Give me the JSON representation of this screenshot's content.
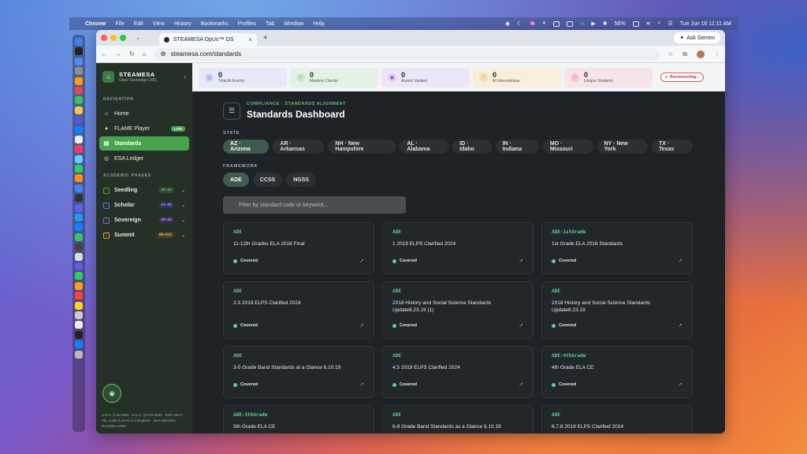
{
  "menubar": {
    "app": "Chrome",
    "items": [
      "File",
      "Edit",
      "View",
      "History",
      "Bookmarks",
      "Profiles",
      "Tab",
      "Window",
      "Help"
    ],
    "battery": "56%",
    "datetime": "Tue Jun 16  11:11 AM"
  },
  "browser": {
    "tab_title": "STEAMESA OpUs™ OS",
    "url": "steamesa.com/standards",
    "ask_gemini": "Ask Gemini"
  },
  "sidebar": {
    "brand": "STEAMESA",
    "subtitle": "Opus Sovereign LMS",
    "nav_heading": "NAVIGATION",
    "nav": [
      {
        "label": "Home",
        "icon": "home-icon"
      },
      {
        "label": "FLAME Player",
        "icon": "flame-icon",
        "badge": "LIVE"
      },
      {
        "label": "Standards",
        "icon": "standards-icon"
      },
      {
        "label": "ESA Ledger",
        "icon": "ledger-icon"
      }
    ],
    "phases_heading": "ACADEMIC PHASES",
    "phases": [
      {
        "label": "Seedling",
        "tag": "G1–G2",
        "color": "#4aa34f"
      },
      {
        "label": "Scholar",
        "tag": "G3–G5",
        "color": "#5b7be0"
      },
      {
        "label": "Sovereign",
        "tag": "G6–G8",
        "color": "#8a62d6"
      },
      {
        "label": "Summit",
        "tag": "G9–G12",
        "color": "#e0a23a"
      }
    ],
    "legal": "A.R.S. § 15-2401 · A.C.A. § 6-18-2501 · RSA 194-F · Ala. Code § 16-6J-1 Compliant · SHA-256 ESA Receipts Active"
  },
  "stats": [
    {
      "value": "0",
      "label": "Total AI Events",
      "bg": "#e6e9f8",
      "icon": "target-icon",
      "icolor": "#5b6fd6"
    },
    {
      "value": "0",
      "label": "Mastery Checks",
      "bg": "#e3f1e6",
      "icon": "check-icon",
      "icolor": "#4aa34f"
    },
    {
      "value": "0",
      "label": "Assets Vaulted",
      "bg": "#ece7f7",
      "icon": "vault-icon",
      "icolor": "#8a62d6"
    },
    {
      "value": "0",
      "label": "AI Interventions",
      "bg": "#f7efdc",
      "icon": "alert-icon",
      "icolor": "#d99a1c"
    },
    {
      "value": "0",
      "label": "Unique Students",
      "bg": "#f7e4ea",
      "icon": "students-icon",
      "icolor": "#d6557a"
    }
  ],
  "reconnecting": "Reconnecting...",
  "page": {
    "breadcrumb": "COMPLIANCE · STANDARDS ALIGNMENT",
    "title": "Standards Dashboard",
    "state_label": "STATE",
    "states": [
      "AZ · Arizona",
      "AR · Arkansas",
      "NH · New Hampshire",
      "AL · Alabama",
      "ID · Idaho",
      "IN · Indiana",
      "MO · Missouri",
      "NY · New York",
      "TX · Texas"
    ],
    "framework_label": "FRAMEWORK",
    "frameworks": [
      "ADE",
      "CCSS",
      "NGSS"
    ],
    "filter_placeholder": "Filter by standard code or keyword..."
  },
  "cards": [
    {
      "code": "ADE",
      "name": "11-12th Grades ELA 2016 Final",
      "status": "Covered"
    },
    {
      "code": "ADE",
      "name": "1 2019 ELPS Clarified 2024",
      "status": "Covered"
    },
    {
      "code": "ADE-1stGrade",
      "name": "1st Grade ELA 2016 Standards",
      "status": "Covered"
    },
    {
      "code": "ADE",
      "name": "2.3 2019 ELPS Clarified 2024",
      "status": "Covered"
    },
    {
      "code": "ADE",
      "name": "2018 History and Social Science Standards Update8.23.19 (1)",
      "status": "Covered"
    },
    {
      "code": "ADE",
      "name": "2018 History and Social Science Standards Update8.23.19",
      "status": "Covered"
    },
    {
      "code": "ADE",
      "name": "3-5 Grade Band Standards at a Glance 6.10.19",
      "status": "Covered"
    },
    {
      "code": "ADE",
      "name": "4.5 2019 ELPS Clarified 2024",
      "status": "Covered"
    },
    {
      "code": "ADE-4thGrade",
      "name": "4th Grade ELA CE",
      "status": "Covered"
    },
    {
      "code": "ADE-5thGrade",
      "name": "5th Grade ELA CE",
      "status": ""
    },
    {
      "code": "ADE",
      "name": "6-8 Grade Band Standards as a Glance 6.10.19",
      "status": ""
    },
    {
      "code": "ADE",
      "name": "6.7.8 2019 ELPS Clarified 2024",
      "status": ""
    }
  ]
}
